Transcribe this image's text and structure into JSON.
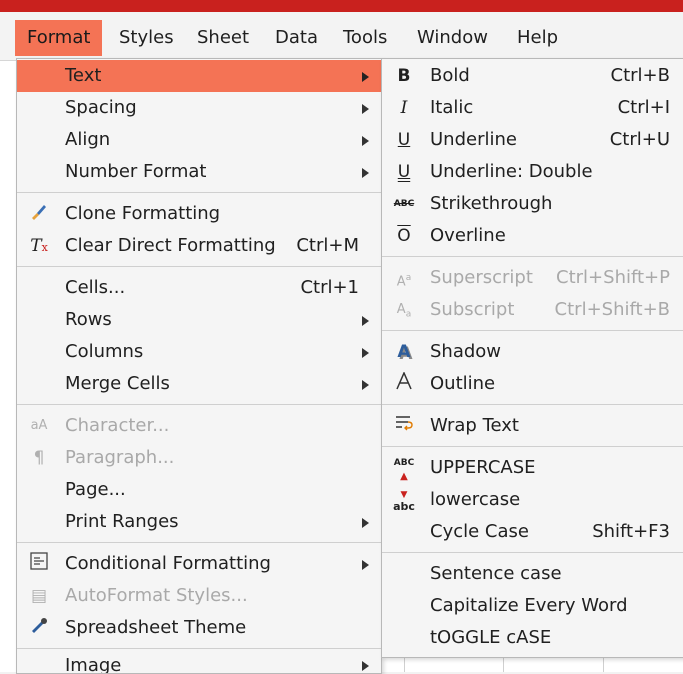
{
  "menubar": {
    "items": [
      {
        "label": "Format",
        "active": true
      },
      {
        "label": "Styles"
      },
      {
        "label": "Sheet"
      },
      {
        "label": "Data"
      },
      {
        "label": "Tools"
      },
      {
        "label": "Window"
      },
      {
        "label": "Help"
      }
    ]
  },
  "format_menu": {
    "text": "Text",
    "spacing": "Spacing",
    "align": "Align",
    "number_format": "Number Format",
    "clone_formatting": "Clone Formatting",
    "clear_direct_formatting": "Clear Direct Formatting",
    "clear_direct_formatting_shortcut": "Ctrl+M",
    "cells": "Cells...",
    "cells_shortcut": "Ctrl+1",
    "rows": "Rows",
    "columns": "Columns",
    "merge_cells": "Merge Cells",
    "character": "Character...",
    "paragraph": "Paragraph...",
    "page": "Page...",
    "print_ranges": "Print Ranges",
    "conditional_formatting": "Conditional Formatting",
    "autoformat_styles": "AutoFormat Styles...",
    "spreadsheet_theme": "Spreadsheet Theme",
    "image": "Image"
  },
  "text_submenu": {
    "bold": "Bold",
    "bold_shortcut": "Ctrl+B",
    "italic": "Italic",
    "italic_shortcut": "Ctrl+I",
    "underline": "Underline",
    "underline_shortcut": "Ctrl+U",
    "underline_double": "Underline: Double",
    "strikethrough": "Strikethrough",
    "overline": "Overline",
    "superscript": "Superscript",
    "superscript_shortcut": "Ctrl+Shift+P",
    "subscript": "Subscript",
    "subscript_shortcut": "Ctrl+Shift+B",
    "shadow": "Shadow",
    "outline": "Outline",
    "wrap_text": "Wrap Text",
    "uppercase": "UPPERCASE",
    "lowercase": "lowercase",
    "cycle_case": "Cycle Case",
    "cycle_case_shortcut": "Shift+F3",
    "sentence_case": "Sentence case",
    "capitalize_every_word": "Capitalize Every Word",
    "toggle_case": "tOGGLE cASE"
  },
  "icons": {
    "bold_glyph": "B",
    "italic_glyph": "I",
    "underline_glyph": "U",
    "strike_glyph": "ABC",
    "overline_glyph": "O",
    "upper_glyph": "ABC",
    "lower_glyph": "abc"
  },
  "colors": {
    "accent": "#f47355",
    "titlebar_red": "#c9211e"
  }
}
